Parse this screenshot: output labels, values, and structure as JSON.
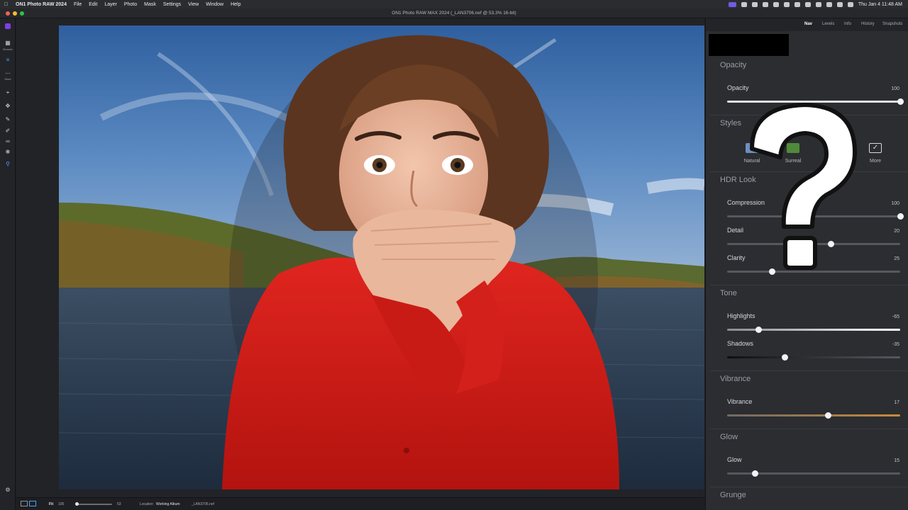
{
  "menubar": {
    "app_name": "ON1 Photo RAW 2024",
    "items": [
      "File",
      "Edit",
      "Layer",
      "Photo",
      "Mask",
      "Settings",
      "View",
      "Window",
      "Help"
    ],
    "clock": "Thu Jan 4  11:48 AM"
  },
  "window": {
    "title": "ON1 Photo RAW MAX 2024 (_LAN3706.nef @ 53.3% 16-bit)"
  },
  "rail": {
    "browse_label": "Browse",
    "more_label": "More"
  },
  "status": {
    "fit": "Fit",
    "zoom_pct": "100",
    "zoom_value": "53",
    "location_label": "Location",
    "album": "Working Album",
    "file": "_LAN3706.nef"
  },
  "panel": {
    "tabs": [
      "Nav",
      "Levels",
      "Info",
      "History",
      "Snapshots"
    ],
    "opacity": {
      "heading": "Opacity",
      "label": "Opacity",
      "value": "100",
      "fraction": 1.0
    },
    "styles": {
      "heading": "Styles",
      "items": [
        "Natural",
        "Surreal",
        "More"
      ]
    },
    "hdr": {
      "heading": "HDR Look",
      "controls": [
        {
          "label": "Compression",
          "value": "100",
          "fraction": 1.0
        },
        {
          "label": "Detail",
          "value": "20",
          "fraction": 0.6
        },
        {
          "label": "Clarity",
          "value": "25",
          "fraction": 0.26
        }
      ]
    },
    "tone": {
      "heading": "Tone",
      "controls": [
        {
          "label": "Highlights",
          "value": "-65",
          "fraction": 0.18
        },
        {
          "label": "Shadows",
          "value": "-35",
          "fraction": 0.33
        }
      ]
    },
    "vibrance": {
      "heading": "Vibrance",
      "label": "Vibrance",
      "value": "17",
      "fraction": 0.58,
      "accent": "#c98a3c"
    },
    "glow": {
      "heading": "Glow",
      "label": "Glow",
      "value": "15",
      "fraction": 0.16
    },
    "grunge": {
      "heading": "Grunge"
    }
  },
  "overlay": {
    "symbol": "?"
  }
}
